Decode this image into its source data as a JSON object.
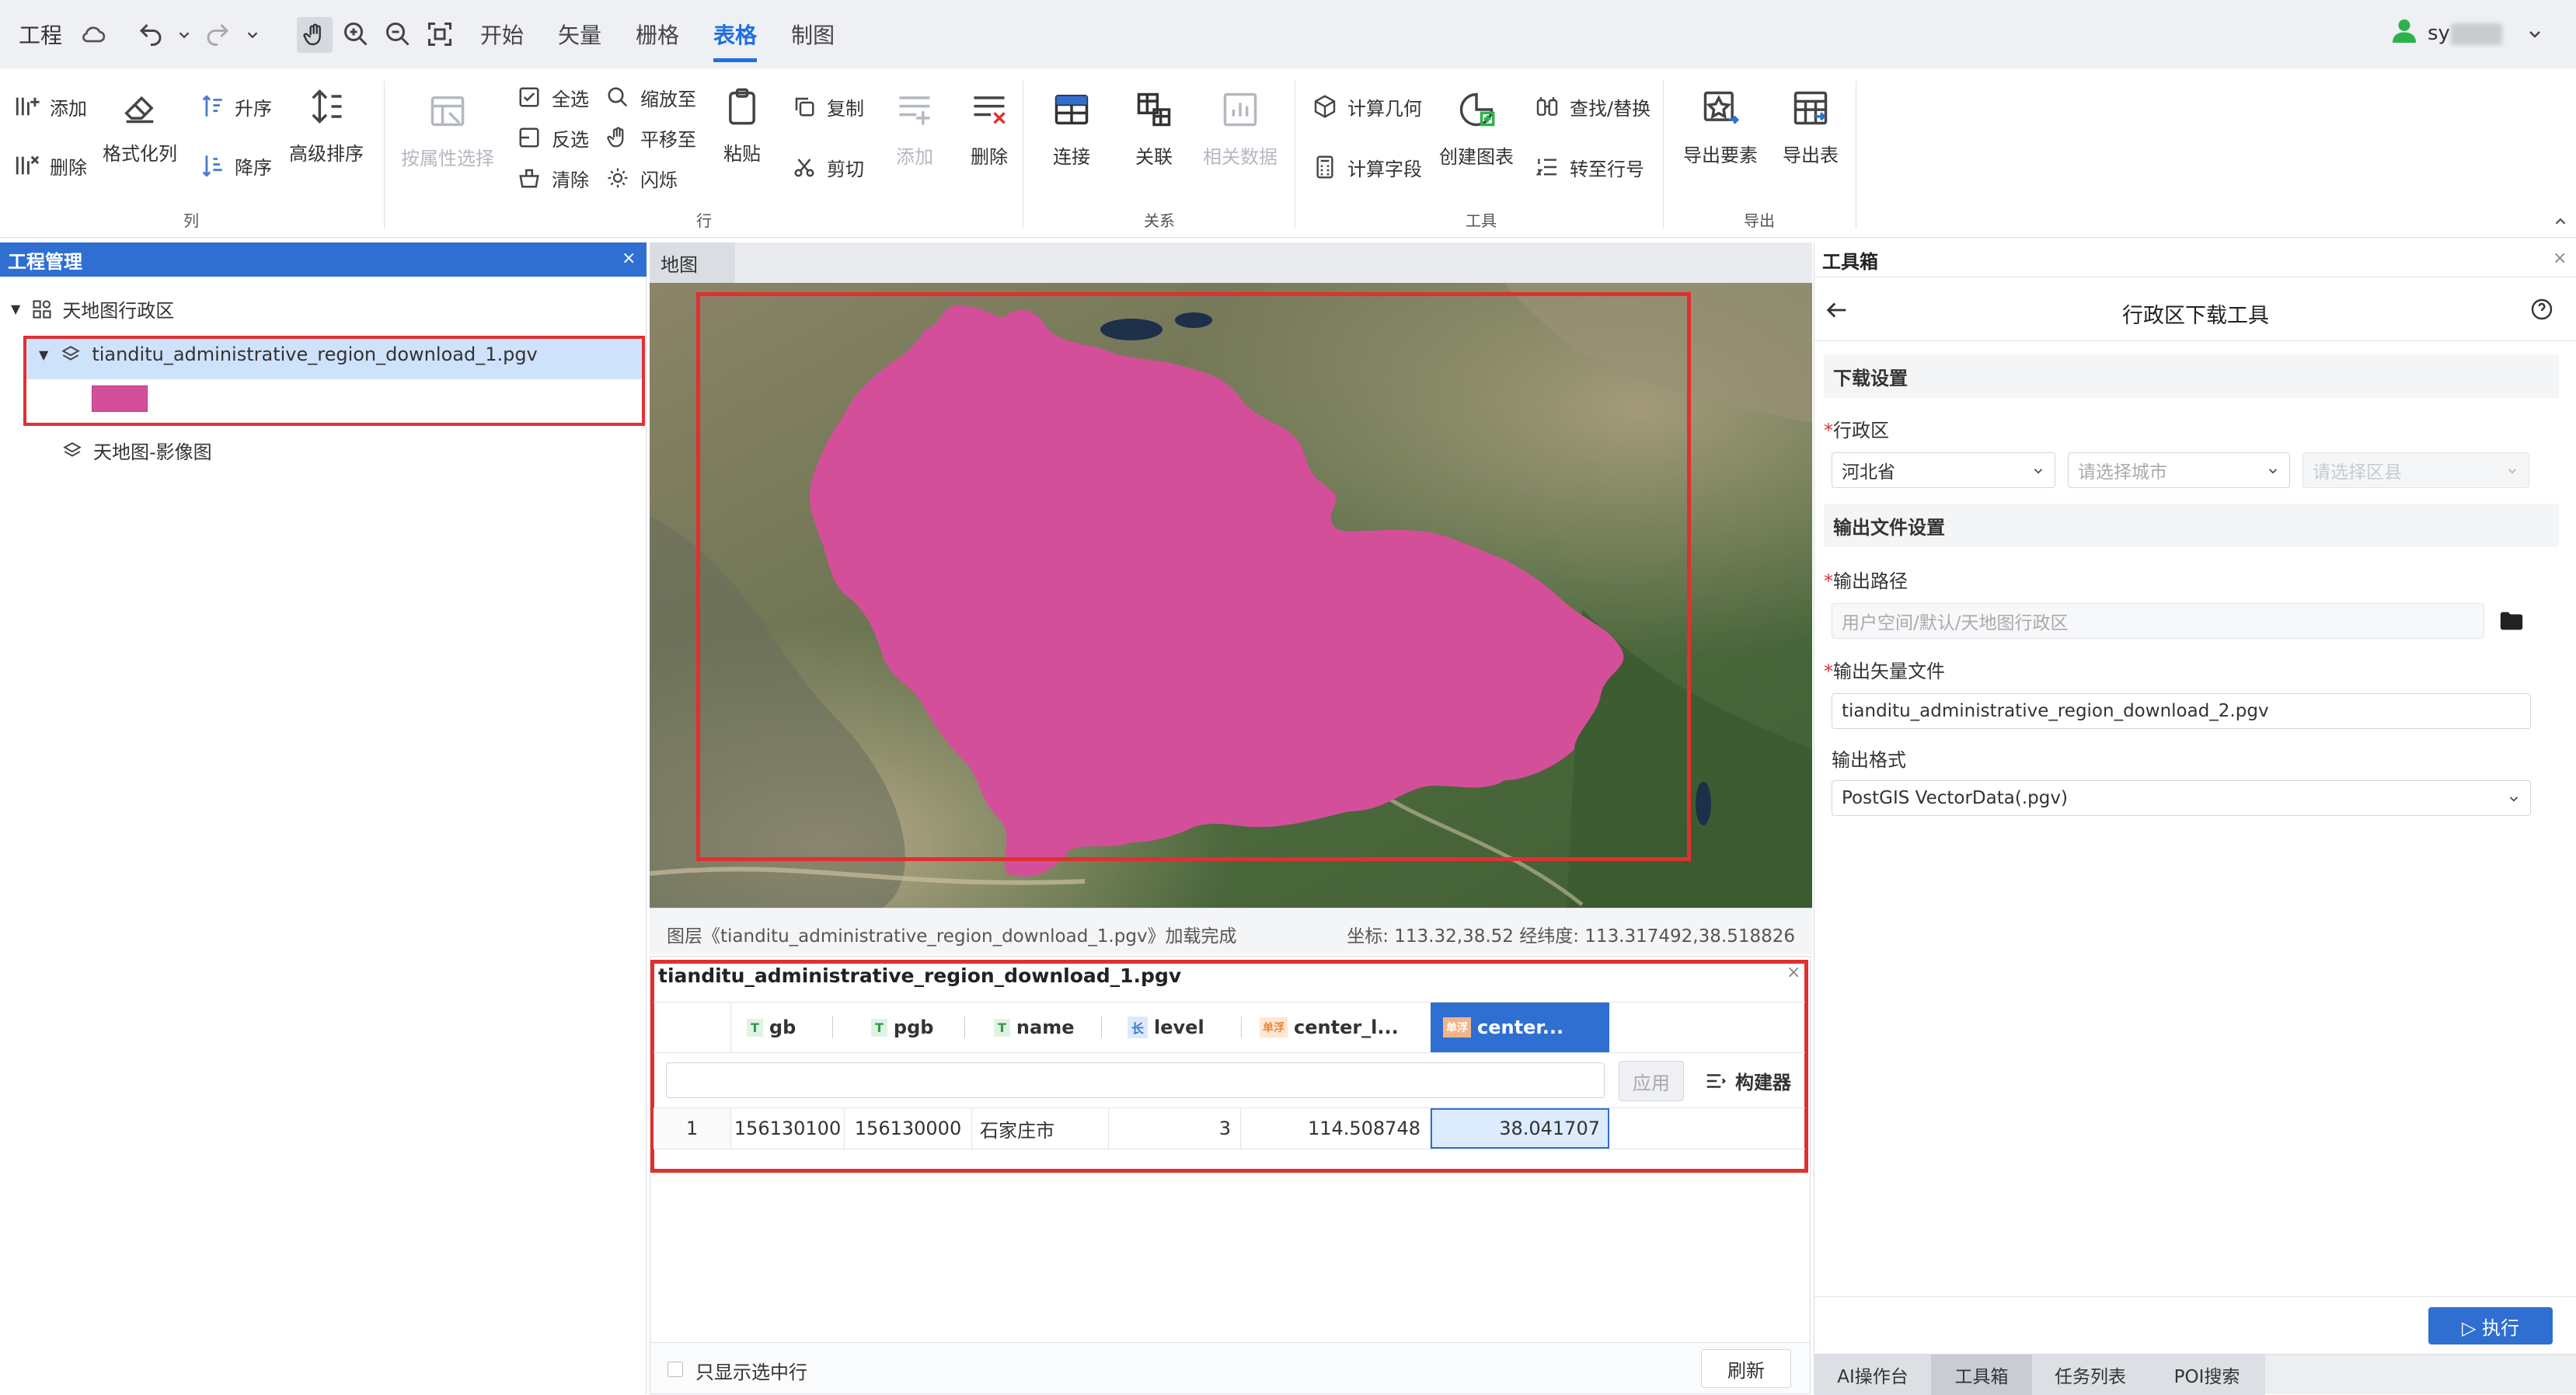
{
  "topbar": {
    "project_label": "工程",
    "menus": [
      "开始",
      "矢量",
      "栅格",
      "表格",
      "制图"
    ],
    "active_menu": "表格",
    "user": "sy"
  },
  "ribbon": {
    "column": {
      "add": "添加",
      "delete": "删除",
      "format": "格式化列",
      "asc": "升序",
      "desc": "降序",
      "advanced_sort": "高级排序",
      "group": "列"
    },
    "row": {
      "attr_select": "按属性选择",
      "select_all": "全选",
      "invert": "反选",
      "clear": "清除",
      "zoom_to": "缩放至",
      "pan_to": "平移至",
      "flash": "闪烁",
      "paste": "粘贴",
      "copy": "复制",
      "cut": "剪切",
      "add": "添加",
      "delete": "删除",
      "group": "行"
    },
    "relation": {
      "join": "连接",
      "relate": "关联",
      "related_data": "相关数据",
      "group": "关系"
    },
    "tools": {
      "calc_geometry": "计算几何",
      "calc_field": "计算字段",
      "create_chart": "创建图表",
      "find_replace": "查找/替换",
      "goto_row": "转至行号",
      "group": "工具"
    },
    "export": {
      "export_features": "导出要素",
      "export_table": "导出表",
      "group": "导出"
    }
  },
  "project_panel": {
    "title": "工程管理",
    "close": "×",
    "root": "天地图行政区",
    "layer": "tianditu_administrative_region_download_1.pgv",
    "layer_color": "#d44f9a",
    "basemap": "天地图-影像图"
  },
  "map": {
    "tab": "地图",
    "status_text": "图层《tianditu_administrative_region_download_1.pgv》加载完成",
    "coords": "坐标: 113.32,38.52 经纬度: 113.317492,38.518826"
  },
  "table": {
    "title": "tianditu_administrative_region_download_1.pgv",
    "close": "×",
    "columns": [
      {
        "type": "T",
        "name": "gb"
      },
      {
        "type": "T",
        "name": "pgb"
      },
      {
        "type": "T",
        "name": "name"
      },
      {
        "type": "长",
        "name": "level"
      },
      {
        "type": "单浮",
        "name": "center_l..."
      },
      {
        "type": "单浮",
        "name": "center..."
      }
    ],
    "apply": "应用",
    "builder": "构建器",
    "rows": [
      {
        "index": "1",
        "gb": "156130100",
        "pgb": "156130000",
        "name": "石家庄市",
        "level": "3",
        "center_lon": "114.508748",
        "center_lat": "38.041707"
      }
    ],
    "only_selected": "只显示选中行",
    "refresh": "刷新"
  },
  "toolbox": {
    "title": "工具箱",
    "close": "×",
    "tool_title": "行政区下载工具",
    "download_settings": "下载设置",
    "region_label": "行政区",
    "province": "河北省",
    "city_placeholder": "请选择城市",
    "district_placeholder": "请选择区县",
    "output_settings": "输出文件设置",
    "output_path_label": "输出路径",
    "output_path_placeholder": "用户空间/默认/天地图行政区",
    "output_file_label": "输出矢量文件",
    "output_file": "tianditu_administrative_region_download_2.pgv",
    "format_label": "输出格式",
    "format": "PostGIS VectorData(.pgv)",
    "run": "▷ 执行",
    "bottom_tabs": [
      "AI操作台",
      "工具箱",
      "任务列表",
      "POI搜索"
    ],
    "active_tab": "工具箱"
  }
}
